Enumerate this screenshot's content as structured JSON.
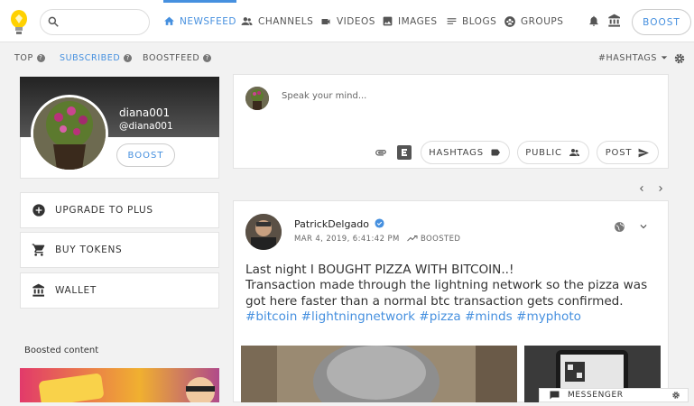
{
  "nav": {
    "items": [
      {
        "label": "NEWSFEED",
        "icon": "home-icon",
        "active": true
      },
      {
        "label": "CHANNELS",
        "icon": "people-icon"
      },
      {
        "label": "VIDEOS",
        "icon": "video-icon"
      },
      {
        "label": "IMAGES",
        "icon": "image-icon"
      },
      {
        "label": "BLOGS",
        "icon": "notes-icon"
      },
      {
        "label": "GROUPS",
        "icon": "groups-icon"
      }
    ],
    "boost_label": "BOOST",
    "accent": "#4690df"
  },
  "subnav": {
    "top": "TOP",
    "subscribed": "SUBSCRIBED",
    "boostfeed": "BOOSTFEED",
    "hashtags": "#HASHTAGS"
  },
  "profile": {
    "name": "diana001",
    "username": "@diana001",
    "boost_label": "BOOST"
  },
  "sidebar": {
    "upgrade": "UPGRADE TO PLUS",
    "tokens": "BUY TOKENS",
    "wallet": "WALLET",
    "boosted_title": "Boosted content"
  },
  "compose": {
    "placeholder": "Speak your mind...",
    "hashtags": "HASHTAGS",
    "public": "PUBLIC",
    "post": "POST"
  },
  "post": {
    "author": "PatrickDelgado",
    "date": "MAR 4, 2019, 6:41:42 PM",
    "boosted": "BOOSTED",
    "line1": "Last night I BOUGHT PIZZA WITH BITCOIN..!",
    "line2": "Transaction made through the lightning network so the pizza was got here faster than a normal btc transaction gets confirmed.",
    "tags": "#bitcoin #lightningnetwork #pizza #minds #myphoto"
  },
  "messenger": {
    "label": "MESSENGER"
  }
}
